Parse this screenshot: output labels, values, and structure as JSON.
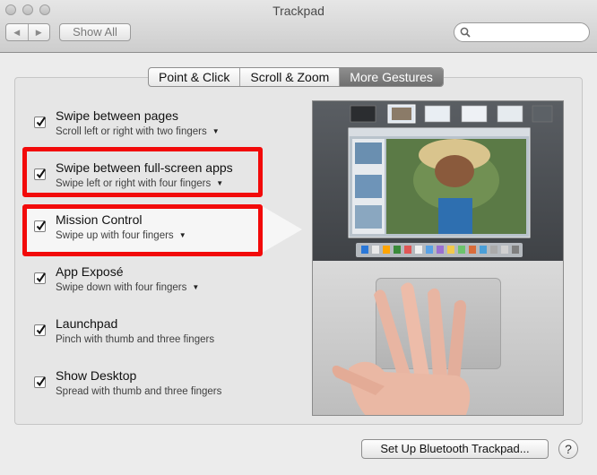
{
  "window": {
    "title": "Trackpad"
  },
  "toolbar": {
    "back_icon": "◀",
    "forward_icon": "▶",
    "show_all_label": "Show All",
    "search_placeholder": ""
  },
  "tabs": [
    {
      "label": "Point & Click",
      "active": false
    },
    {
      "label": "Scroll & Zoom",
      "active": false
    },
    {
      "label": "More Gestures",
      "active": true
    }
  ],
  "gestures": [
    {
      "name": "Swipe between pages",
      "description": "Scroll left or right with two fingers",
      "checked": true,
      "has_menu": true
    },
    {
      "name": "Swipe between full-screen apps",
      "description": "Swipe left or right with four fingers",
      "checked": true,
      "has_menu": true
    },
    {
      "name": "Mission Control",
      "description": "Swipe up with four fingers",
      "checked": true,
      "has_menu": true
    },
    {
      "name": "App Exposé",
      "description": "Swipe down with four fingers",
      "checked": true,
      "has_menu": true
    },
    {
      "name": "Launchpad",
      "description": "Pinch with thumb and three fingers",
      "checked": true,
      "has_menu": false
    },
    {
      "name": "Show Desktop",
      "description": "Spread with thumb and three fingers",
      "checked": true,
      "has_menu": false
    }
  ],
  "annotation_color": "#f20a0a",
  "footer": {
    "setup_button_label": "Set Up Bluetooth Trackpad...",
    "help_label": "?"
  }
}
